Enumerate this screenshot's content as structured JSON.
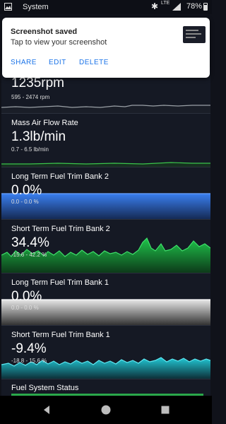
{
  "status_bar": {
    "label": "System",
    "network": "LTE",
    "battery": "78%"
  },
  "notification": {
    "title": "Screenshot saved",
    "subtitle": "Tap to view your screenshot",
    "actions": {
      "share": "SHARE",
      "edit": "EDIT",
      "delete": "DELETE"
    }
  },
  "gauges": [
    {
      "title": "",
      "value": "1235rpm",
      "range": "595 - 2474 rpm",
      "color": "#9aa0a6"
    },
    {
      "title": "Mass Air Flow Rate",
      "value": "1.3lb/min",
      "range": "0.7 - 6.5 lb/min",
      "color": "#3bc44b"
    },
    {
      "title": "Long Term Fuel Trim Bank 2",
      "value": "0.0%",
      "range": "0.0 - 0.0 %",
      "color": "#2f6fe0"
    },
    {
      "title": "Short Term Fuel Trim Bank 2",
      "value": "34.4%",
      "range": "-15.6 - 42.2 %",
      "color": "#1fa83a"
    },
    {
      "title": "Long Term Fuel Trim Bank 1",
      "value": "0.0%",
      "range": "0.0 - 0.0 %",
      "color": "#d9d9d9"
    },
    {
      "title": "Short Term Fuel Trim Bank 1",
      "value": "-9.4%",
      "range": "-18.8 - 15.6 %",
      "color": "#1fb8c9"
    },
    {
      "title": "Fuel System Status",
      "value": "",
      "range": "",
      "color": "#2aa84a"
    }
  ],
  "nav": {
    "back": "back-icon",
    "home": "home-icon",
    "recents": "recents-icon"
  }
}
